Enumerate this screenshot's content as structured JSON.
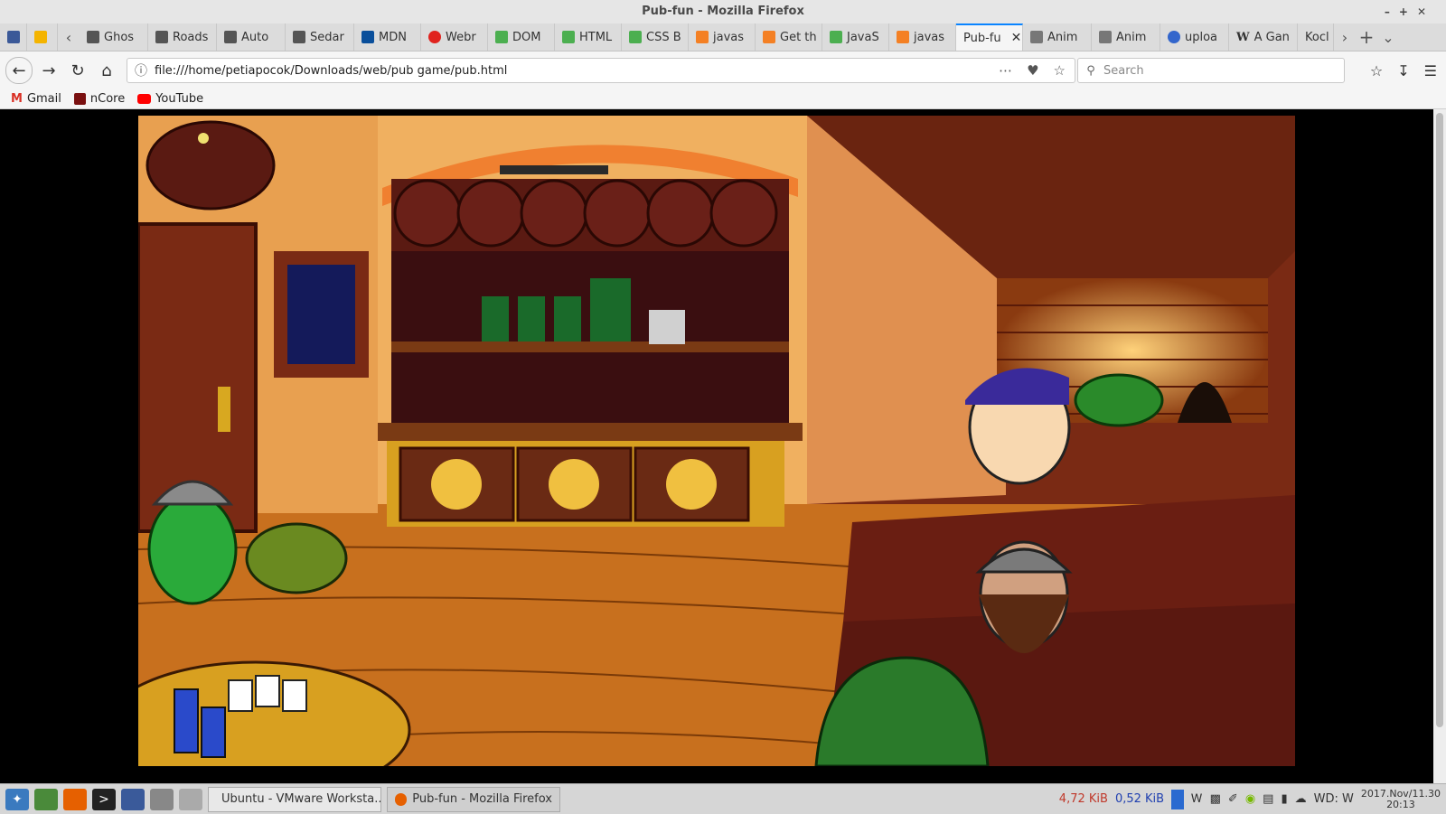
{
  "window": {
    "title": "Pub-fun - Mozilla Firefox"
  },
  "tabs": [
    {
      "label": "",
      "icon": "facebook-icon",
      "color": "#3b5998"
    },
    {
      "label": "",
      "icon": "keep-icon",
      "color": "#f4b400"
    },
    {
      "label": "Ghos",
      "icon": "page-icon",
      "color": "#555555"
    },
    {
      "label": "Roads",
      "icon": "page-icon",
      "color": "#555555"
    },
    {
      "label": "Auto",
      "icon": "page-icon",
      "color": "#555555"
    },
    {
      "label": "Sedar",
      "icon": "page-icon",
      "color": "#555555"
    },
    {
      "label": "MDN",
      "icon": "mdn-icon",
      "color": "#0a4f9b"
    },
    {
      "label": "Webr",
      "icon": "opera-icon",
      "color": "#e0231e"
    },
    {
      "label": "DOM",
      "icon": "w3-icon",
      "color": "#4caf50"
    },
    {
      "label": "HTML",
      "icon": "w3-icon",
      "color": "#4caf50"
    },
    {
      "label": "CSS B",
      "icon": "w3-icon",
      "color": "#4caf50"
    },
    {
      "label": "javas",
      "icon": "stackoverflow-icon",
      "color": "#f48024"
    },
    {
      "label": "Get th",
      "icon": "stackoverflow-icon",
      "color": "#f48024"
    },
    {
      "label": "JavaS",
      "icon": "w3-icon",
      "color": "#4caf50"
    },
    {
      "label": "javas",
      "icon": "stackoverflow-icon",
      "color": "#f48024"
    },
    {
      "label": "Pub-fu",
      "icon": "none",
      "color": "#f5f5f5",
      "active": true
    },
    {
      "label": "Anim",
      "icon": "anime-icon",
      "color": "#777777"
    },
    {
      "label": "Anim",
      "icon": "anime-icon",
      "color": "#777777"
    },
    {
      "label": "uploa",
      "icon": "wikimedia-icon",
      "color": "#3366cc"
    },
    {
      "label": "A Gan",
      "icon": "wikipedia-icon",
      "color": "#000000"
    },
    {
      "label": "Kocl",
      "icon": "page-icon",
      "color": "#555555"
    }
  ],
  "nav": {
    "url": "file:///home/petiapocok/Downloads/web/pub game/pub.html",
    "search_placeholder": "Search"
  },
  "bookmarks": [
    {
      "label": "Gmail",
      "icon": "gmail-icon",
      "color": "#d93025"
    },
    {
      "label": "nCore",
      "icon": "ncore-icon",
      "color": "#7a1010"
    },
    {
      "label": "YouTube",
      "icon": "youtube-icon",
      "color": "#ff0000"
    }
  ],
  "taskbar": {
    "tasks": [
      {
        "label": "Ubuntu - VMware Worksta...",
        "icon": "vmware-icon"
      },
      {
        "label": "Pub-fun - Mozilla Firefox",
        "icon": "firefox-icon"
      }
    ],
    "net_down": "4,72 KiB",
    "net_up": "0,52 KiB",
    "keyboard": "WD: W",
    "date": "2017.Nov/11.30",
    "time": "20:13"
  },
  "colors": {
    "accent": "#0a84ff",
    "net_down": "#c0392b",
    "net_up": "#2040b0"
  }
}
